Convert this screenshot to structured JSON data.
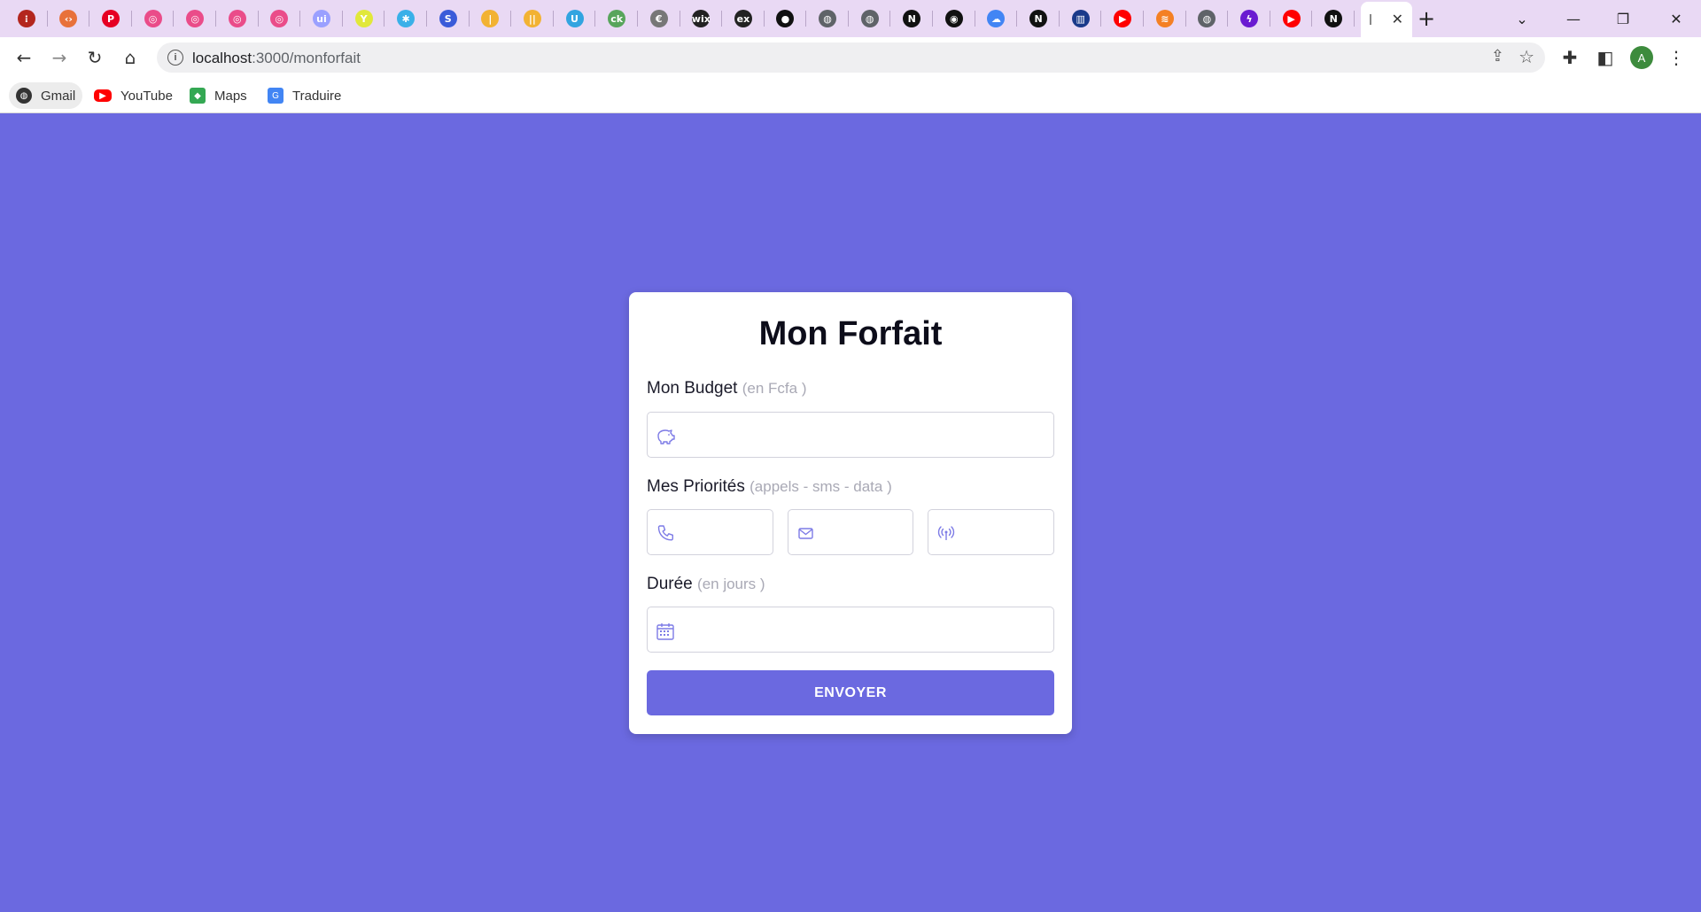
{
  "browser": {
    "tabs": [
      {
        "icon": "dots-icon",
        "color": "#b3261e",
        "glyph": "⁝"
      },
      {
        "icon": "code-icon",
        "color": "#e8713a",
        "glyph": "‹›"
      },
      {
        "icon": "pinterest-icon",
        "color": "#e60023",
        "glyph": "P"
      },
      {
        "icon": "dribbble-icon",
        "color": "#ea4c89",
        "glyph": "◎"
      },
      {
        "icon": "dribbble-icon",
        "color": "#ea4c89",
        "glyph": "◎"
      },
      {
        "icon": "dribbble-icon",
        "color": "#ea4c89",
        "glyph": "◎"
      },
      {
        "icon": "dribbble-icon",
        "color": "#ea4c89",
        "glyph": "◎"
      },
      {
        "icon": "ui-icon",
        "color": "#9aa0ff",
        "glyph": "ui"
      },
      {
        "icon": "y-icon",
        "color": "#e1e83a",
        "glyph": "Y"
      },
      {
        "icon": "puzzle-color-icon",
        "color": "#3ab0e8",
        "glyph": "✱"
      },
      {
        "icon": "s-icon",
        "color": "#3a5bd9",
        "glyph": "S"
      },
      {
        "icon": "bars-icon",
        "color": "#f2b233",
        "glyph": "|"
      },
      {
        "icon": "bars-icon",
        "color": "#f2b233",
        "glyph": "||"
      },
      {
        "icon": "u-icon",
        "color": "#32a4e0",
        "glyph": "U"
      },
      {
        "icon": "ck-icon",
        "color": "#58a55c",
        "glyph": "ck"
      },
      {
        "icon": "coin-icon",
        "color": "#777777",
        "glyph": "€"
      },
      {
        "icon": "wix-icon",
        "color": "#222222",
        "glyph": "wix"
      },
      {
        "icon": "ex-icon",
        "color": "#222222",
        "glyph": "ex"
      },
      {
        "icon": "dark-circle-icon",
        "color": "#111111",
        "glyph": "●"
      },
      {
        "icon": "globe-icon",
        "color": "#5f6368",
        "glyph": "◍"
      },
      {
        "icon": "globe-icon",
        "color": "#5f6368",
        "glyph": "◍"
      },
      {
        "icon": "notion-icon",
        "color": "#111111",
        "glyph": "N"
      },
      {
        "icon": "github-icon",
        "color": "#111111",
        "glyph": "◉"
      },
      {
        "icon": "cloud-icon",
        "color": "#4285f4",
        "glyph": "☁"
      },
      {
        "icon": "notion-icon",
        "color": "#111111",
        "glyph": "N"
      },
      {
        "icon": "bank-icon",
        "color": "#1a3a8a",
        "glyph": "▥"
      },
      {
        "icon": "youtube-icon",
        "color": "#ff0000",
        "glyph": "▶"
      },
      {
        "icon": "stack-icon",
        "color": "#f48024",
        "glyph": "≋"
      },
      {
        "icon": "globe-icon",
        "color": "#5f6368",
        "glyph": "◍"
      },
      {
        "icon": "bolt-icon",
        "color": "#6a1bd1",
        "glyph": "ϟ"
      },
      {
        "icon": "youtube-icon",
        "color": "#ff0000",
        "glyph": "▶"
      },
      {
        "icon": "notion-icon",
        "color": "#111111",
        "glyph": "N"
      }
    ],
    "new_tab_label": "+",
    "url_host": "localhost",
    "url_path": ":3000/monforfait",
    "profile_initial": "A",
    "bookmarks": [
      {
        "label": "Gmail",
        "icon": "globe-icon",
        "color": "#333333"
      },
      {
        "label": "YouTube",
        "icon": "youtube-icon",
        "color": "#ff0000"
      },
      {
        "label": "Maps",
        "icon": "maps-icon",
        "color": "#34a853"
      },
      {
        "label": "Traduire",
        "icon": "translate-icon",
        "color": "#4285f4"
      }
    ]
  },
  "form": {
    "title": "Mon Forfait",
    "budget_label": "Mon Budget",
    "budget_hint": "(en Fcfa )",
    "budget_value": "",
    "priorities_label": "Mes Priorités",
    "priorities_hint": "(appels - sms - data )",
    "calls_value": "",
    "sms_value": "",
    "data_value": "",
    "duration_label": "Durée",
    "duration_hint": "(en jours )",
    "duration_value": "",
    "submit_label": "ENVOYER",
    "accent_color": "#6b69e0"
  }
}
